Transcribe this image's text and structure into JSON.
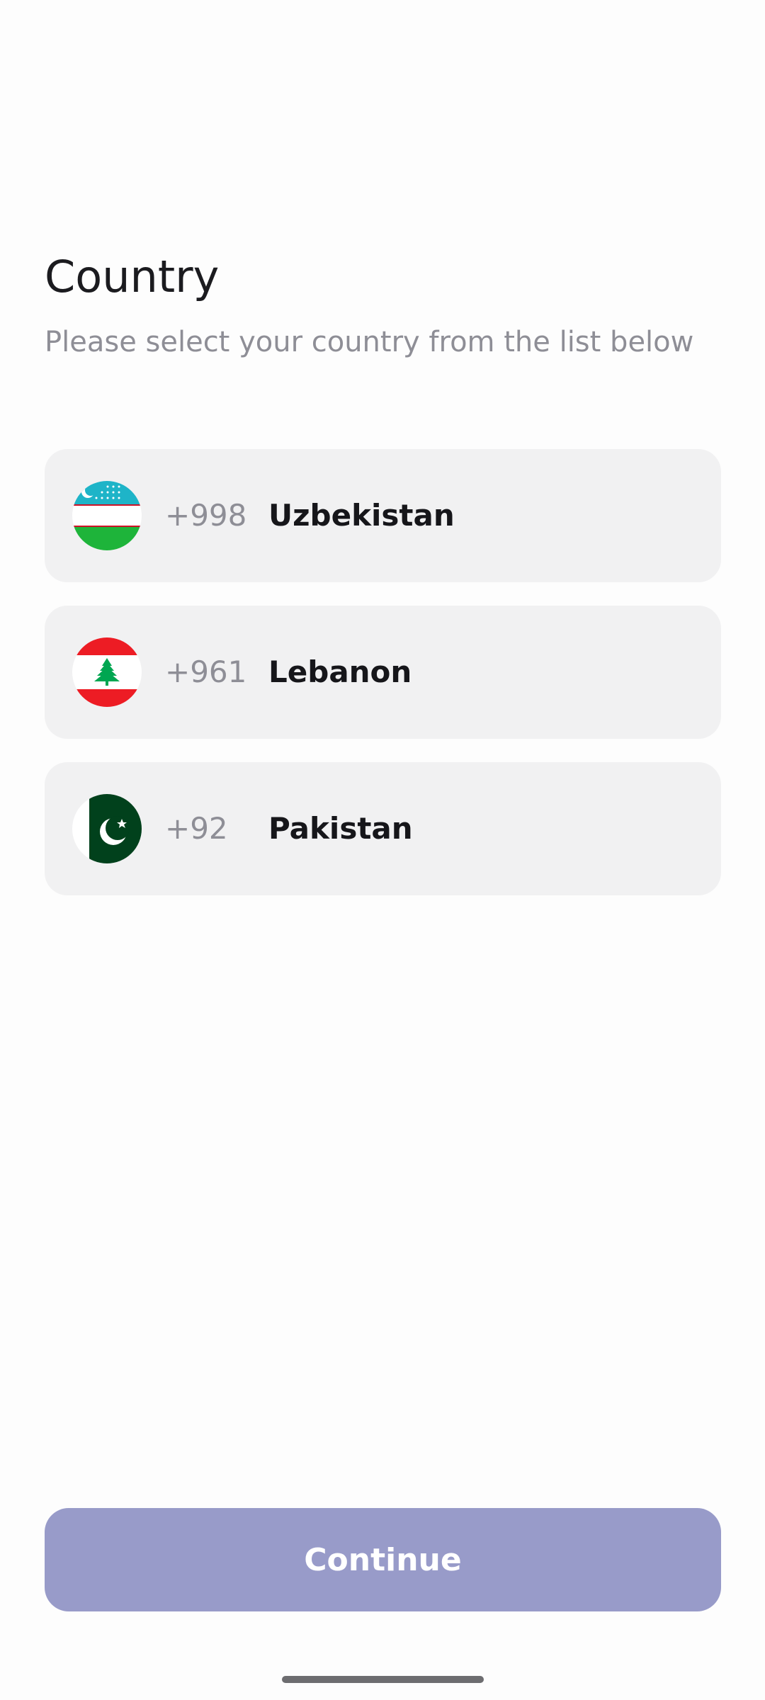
{
  "header": {
    "title": "Country",
    "subtitle": "Please select your country from the list below"
  },
  "countries": [
    {
      "code": "+998",
      "name": "Uzbekistan",
      "flag_icon": "uzbekistan-flag-icon"
    },
    {
      "code": "+961",
      "name": "Lebanon",
      "flag_icon": "lebanon-flag-icon"
    },
    {
      "code": "+92",
      "name": "Pakistan",
      "flag_icon": "pakistan-flag-icon"
    }
  ],
  "footer": {
    "continue_label": "Continue"
  },
  "colors": {
    "row_background": "#f1f1f2",
    "button_background": "#989bc9",
    "muted_text": "#8e8e96",
    "primary_text": "#16161a"
  }
}
